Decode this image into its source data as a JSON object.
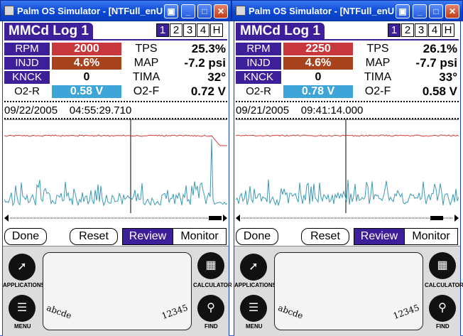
{
  "windows": [
    {
      "window_title": "Palm OS Simulator - [NTFull_enU",
      "app_title": "MMCd Log 1",
      "pages": [
        "1",
        "2",
        "3",
        "4",
        "H"
      ],
      "selected_page": "1",
      "rows": [
        {
          "label": "RPM",
          "value": "2000",
          "label2": "TPS",
          "value2": "25.3%",
          "label_color": "#3d1f99",
          "value_color": "#c8373c"
        },
        {
          "label": "INJD",
          "value": "4.6%",
          "label2": "MAP",
          "value2": "-7.2 psi",
          "label_color": "#3d1f99",
          "value_color": "#a8431e"
        },
        {
          "label": "KNCK",
          "value": "0",
          "label2": "TIMA",
          "value2": "32°",
          "label_color": "#3d1f99",
          "value_color": ""
        },
        {
          "label": "O2-R",
          "value": "0.58 V",
          "label2": "O2-F",
          "value2": "0.72 V",
          "label_color": "",
          "value_color": "#3ea5d8"
        }
      ],
      "date": "09/22/2005",
      "time": "04:55:29.710",
      "buttons": {
        "done": "Done",
        "reset": "Reset",
        "review": "Review",
        "monitor": "Monitor"
      },
      "silkscreen": {
        "applications": "APPLICATIONS",
        "menu": "MENU",
        "calculator": "CALCULATOR",
        "find": "FIND",
        "abc": "abcde",
        "num": "12345"
      }
    },
    {
      "window_title": "Palm OS Simulator - [NTFull_enU",
      "app_title": "MMCd Log 1",
      "pages": [
        "1",
        "2",
        "3",
        "4",
        "H"
      ],
      "selected_page": "1",
      "rows": [
        {
          "label": "RPM",
          "value": "2250",
          "label2": "TPS",
          "value2": "26.1%",
          "label_color": "#3d1f99",
          "value_color": "#c8373c"
        },
        {
          "label": "INJD",
          "value": "4.6%",
          "label2": "MAP",
          "value2": "-7.7 psi",
          "label_color": "#3d1f99",
          "value_color": "#a8431e"
        },
        {
          "label": "KNCK",
          "value": "0",
          "label2": "TIMA",
          "value2": "33°",
          "label_color": "#3d1f99",
          "value_color": ""
        },
        {
          "label": "O2-R",
          "value": "0.78 V",
          "label2": "O2-F",
          "value2": "0.58 V",
          "label_color": "",
          "value_color": "#3ea5d8"
        }
      ],
      "date": "09/21/2005",
      "time": "09:41:14.000",
      "buttons": {
        "done": "Done",
        "reset": "Reset",
        "review": "Review",
        "monitor": "Monitor"
      },
      "silkscreen": {
        "applications": "APPLICATIONS",
        "menu": "MENU",
        "calculator": "CALCULATOR",
        "find": "FIND",
        "abc": "abcde",
        "num": "12345"
      }
    }
  ],
  "colors": {
    "purple": "#3d1f99",
    "red": "#c8373c",
    "brown": "#a8431e",
    "cyan": "#3ea5d8",
    "graph_red": "#d23a3a",
    "graph_cyan": "#3a9ab5"
  }
}
